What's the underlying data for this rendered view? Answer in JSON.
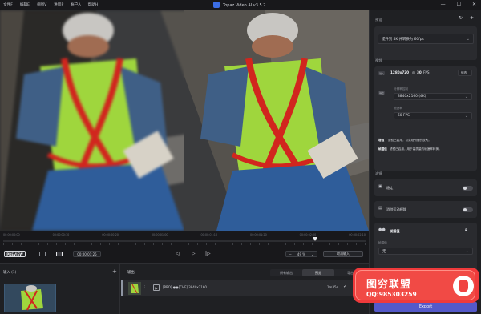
{
  "window": {
    "title": "Topaz Video AI  v3.5.2",
    "menu": [
      "文件F",
      "编辑E",
      "视图V",
      "进程P",
      "帐户A",
      "帮助H"
    ],
    "controls": [
      "—",
      "☐",
      "✕"
    ]
  },
  "timeline": {
    "labels": [
      "00:00:00:00",
      "00:00:00:10",
      "00:00:00:20",
      "00:00:01:00",
      "00:00:01:10",
      "00:00:01:20",
      "00:00:02:00",
      "00:00:02:10"
    ],
    "playhead_fraction": 0.86
  },
  "controls": {
    "preview_label": "PREVIEW",
    "timecode": "00:00:01:25",
    "zoom": "49 %",
    "compare": "取消输入",
    "prev": "◁|",
    "play": "▷",
    "next": "|▷"
  },
  "bottom": {
    "import_label": "输入 (1)",
    "import_plus": "+",
    "output_label": "输出",
    "tabs": [
      "所有输出",
      "预览",
      "导出"
    ],
    "active_tab": "预览",
    "row_text": "[PRO] ●●[CHF] 3840x2160",
    "row_duration": "1m35s",
    "row_check": "✓"
  },
  "panel": {
    "preset_head": "预设",
    "preset_value": "提升到 4K 并转换为 60fps",
    "video_head": "视频",
    "input_badge": "输入",
    "input_res": "1280x720",
    "input_fps_prefix": "@",
    "input_fps": "30",
    "input_fps_unit": "FPS",
    "swap_btn": "修改",
    "output_badge": "输出",
    "resolution_label": "分辨率控制",
    "resolution_value": "3840x2160 (4K)",
    "fps_label": "帧速率",
    "fps_value": "60 FPS",
    "note1_key": "增强",
    "note1_text": "滤镜已启用，以实现所需的放大。",
    "note2_key": "帧插值",
    "note2_text": "滤镜已启用，用于高质量的帧速率转换。",
    "filters_head": "滤镜",
    "stabilize": "稳定",
    "motion_deblur": "消除运动模糊",
    "frame_interp": "帧插值",
    "model_label": "帧插值",
    "model_value": "无",
    "export": "Export"
  },
  "watermark": {
    "title": "图穷联盟",
    "qq": "QQ:985303259"
  }
}
